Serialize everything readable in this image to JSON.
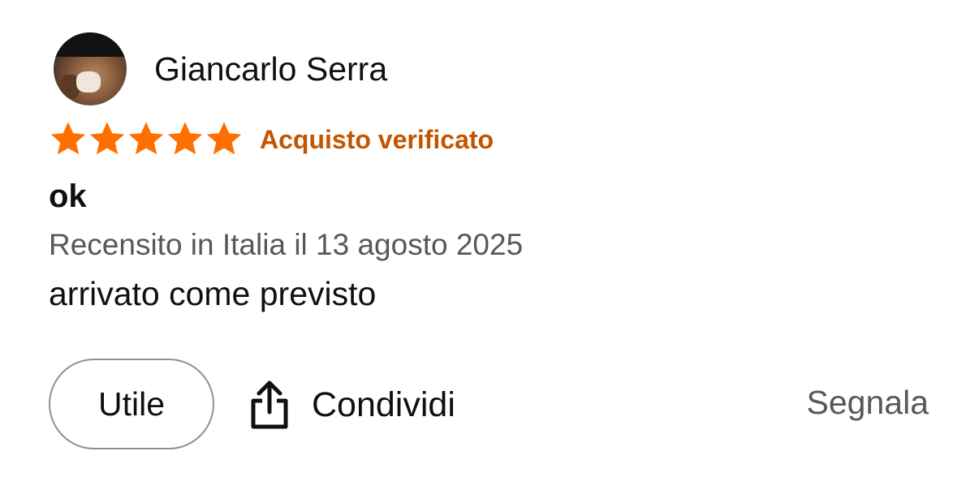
{
  "review": {
    "reviewer": {
      "name": "Giancarlo Serra",
      "avatar_icon": "user-photo-avatar"
    },
    "rating": {
      "stars": 5,
      "max_stars": 5,
      "star_color": "#ff6f00"
    },
    "badge": {
      "label": "Acquisto verificato",
      "color": "#c45500"
    },
    "title": "ok",
    "meta": "Recensito in Italia il 13 agosto 2025",
    "body": "arrivato come previsto"
  },
  "actions": {
    "helpful_label": "Utile",
    "share_label": "Condividi",
    "share_icon": "share-upload-icon",
    "report_label": "Segnala"
  }
}
